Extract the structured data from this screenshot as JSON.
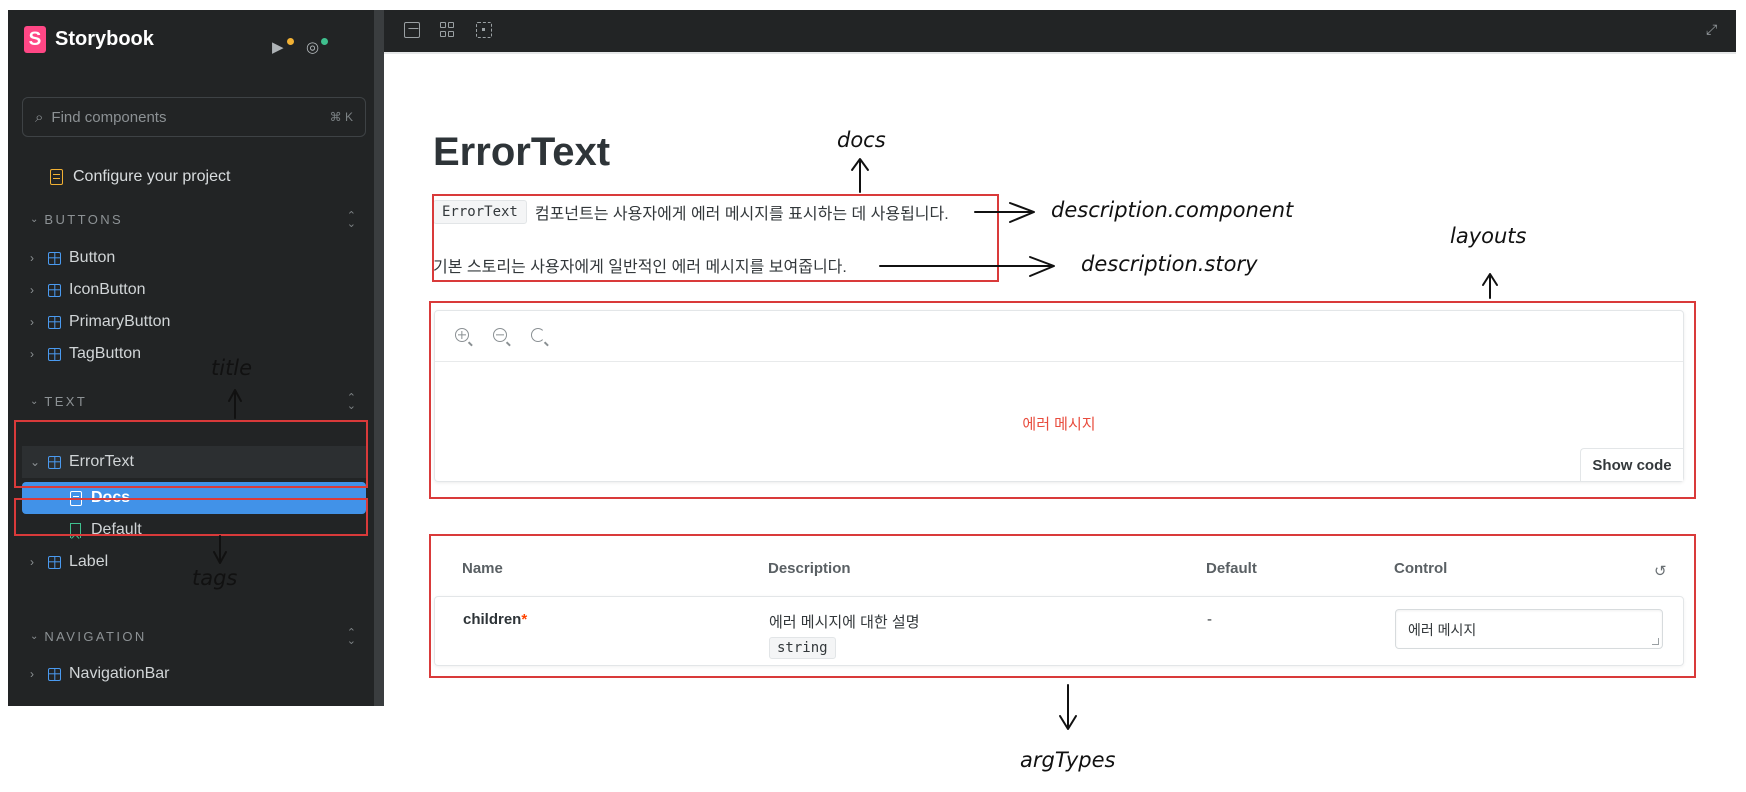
{
  "sidebar": {
    "brand": "Storybook",
    "logo_letter": "S",
    "search_placeholder": "Find components",
    "search_shortcut": "⌘ K",
    "configure": "Configure your project",
    "groups": [
      {
        "title": "BUTTONS",
        "items": [
          "Button",
          "IconButton",
          "PrimaryButton",
          "TagButton"
        ]
      },
      {
        "title": "TEXT",
        "items": [
          "ErrorText",
          "Docs",
          "Default",
          "Label"
        ]
      },
      {
        "title": "NAVIGATION",
        "items": [
          "NavigationBar"
        ]
      }
    ],
    "selected": "Docs",
    "colors": {
      "background": "#222425",
      "selected": "#4192e8",
      "component_icon": "#4a9af0",
      "story_icon": "#3fc08e",
      "brand": "#ff4785"
    }
  },
  "toolbar": {
    "icons": [
      "image-icon",
      "grid-icon",
      "frame-icon",
      "fullscreen-icon"
    ]
  },
  "docs": {
    "title": "ErrorText",
    "component_code": "ErrorText",
    "component_description": "컴포넌트는 사용자에게 에러 메시지를 표시하는 데 사용됩니다.",
    "story_description": "기본 스토리는 사용자에게 일반적인 에러 메시지를 보여줍니다.",
    "preview": {
      "message": "에러 메시지",
      "show_code": "Show code",
      "message_color": "#e84c3d"
    },
    "argtypes": {
      "headers": {
        "name": "Name",
        "description": "Description",
        "default": "Default",
        "control": "Control"
      },
      "rows": [
        {
          "name": "children",
          "required_mark": "*",
          "description": "에러 메시지에 대한 설명",
          "type": "string",
          "default": "-",
          "control_value": "에러 메시지"
        }
      ]
    }
  },
  "annotations": {
    "docs": "docs",
    "description_component": "description.component",
    "description_story": "description.story",
    "layouts": "layouts",
    "title": "title",
    "tags": "tags",
    "argtypes": "argTypes",
    "box_color": "#d93a3a"
  }
}
